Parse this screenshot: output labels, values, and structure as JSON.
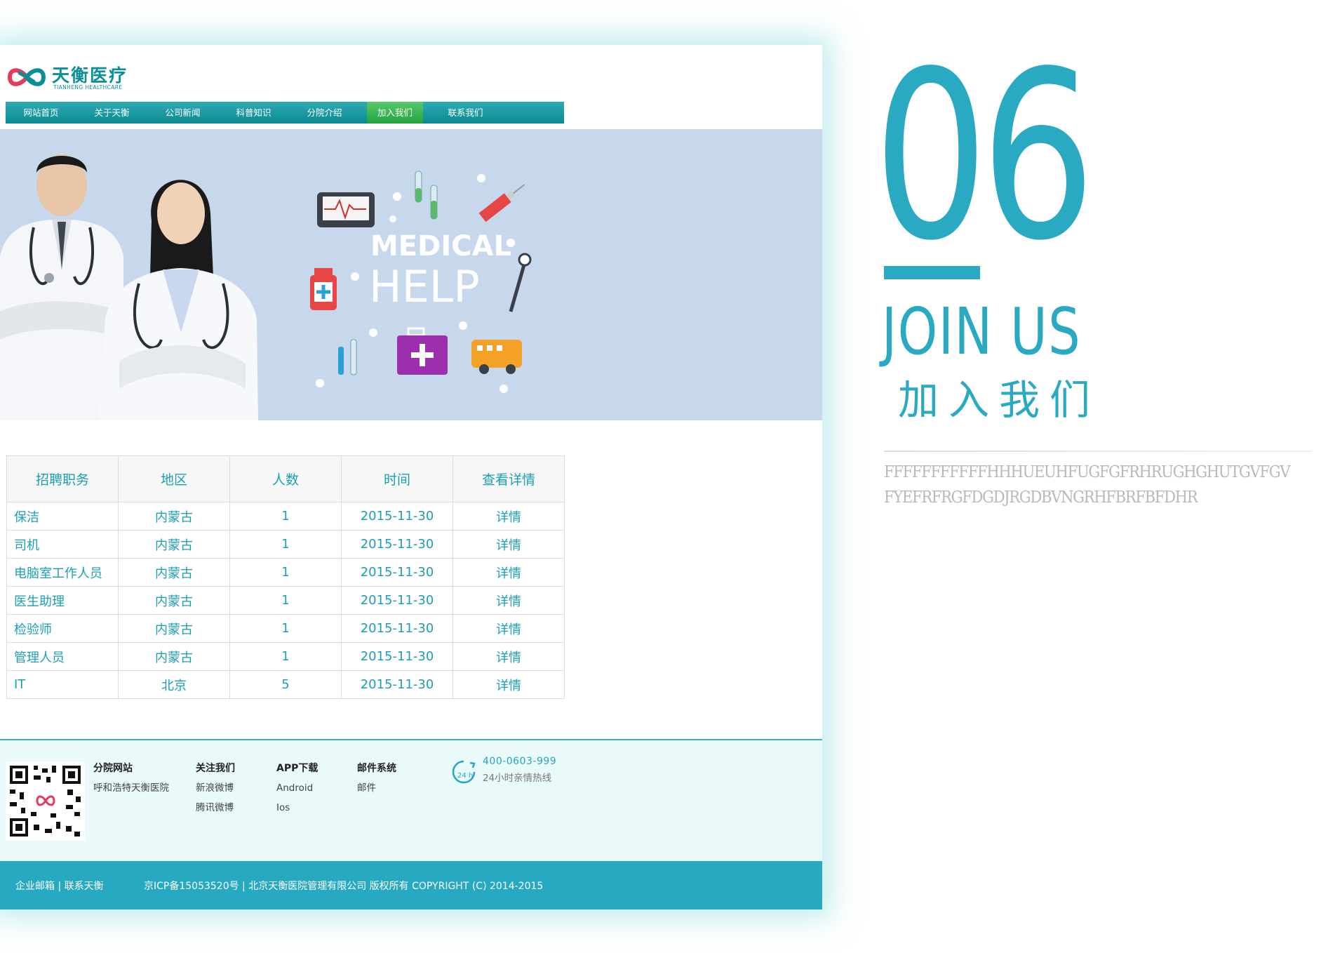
{
  "logo": {
    "name": "天衡医疗",
    "subtitle": "TIANHENG HEALTHCARE"
  },
  "nav": {
    "items": [
      {
        "label": "网站首页"
      },
      {
        "label": "关于天衡"
      },
      {
        "label": "公司新闻"
      },
      {
        "label": "科普知识"
      },
      {
        "label": "分院介绍"
      },
      {
        "label": "加入我们",
        "active": true
      },
      {
        "label": "联系我们"
      }
    ]
  },
  "banner": {
    "title_line1": "MEDICAL",
    "title_line2": "HELP"
  },
  "jobs": {
    "headers": [
      "招聘职务",
      "地区",
      "人数",
      "时间",
      "查看详情"
    ],
    "rows": [
      {
        "title": "保洁",
        "region": "内蒙古",
        "count": "1",
        "date": "2015-11-30",
        "detail": "详情"
      },
      {
        "title": "司机",
        "region": "内蒙古",
        "count": "1",
        "date": "2015-11-30",
        "detail": "详情"
      },
      {
        "title": "电脑室工作人员",
        "region": "内蒙古",
        "count": "1",
        "date": "2015-11-30",
        "detail": "详情"
      },
      {
        "title": "医生助理",
        "region": "内蒙古",
        "count": "1",
        "date": "2015-11-30",
        "detail": "详情"
      },
      {
        "title": "检验师",
        "region": "内蒙古",
        "count": "1",
        "date": "2015-11-30",
        "detail": "详情"
      },
      {
        "title": "管理人员",
        "region": "内蒙古",
        "count": "1",
        "date": "2015-11-30",
        "detail": "详情"
      },
      {
        "title": "IT",
        "region": "北京",
        "count": "5",
        "date": "2015-11-30",
        "detail": "详情"
      }
    ]
  },
  "footer": {
    "branch": {
      "title": "分院网站",
      "items": [
        "呼和浩特天衡医院"
      ]
    },
    "follow": {
      "title": "关注我们",
      "items": [
        "新浪微博",
        "腾讯微博"
      ]
    },
    "app": {
      "title": "APP下载",
      "items": [
        "Android",
        "Ios"
      ]
    },
    "mail": {
      "title": "邮件系统",
      "items": [
        "邮件"
      ]
    },
    "hotline": {
      "number": "400-0603-999",
      "text": "24小时亲情热线",
      "icon_label": "24 h"
    },
    "bottom_links": "企业邮箱 | 联系天衡",
    "copyright": "京ICP备15053520号 | 北京天衡医院管理有限公司 版权所有 COPYRIGHT (C) 2014-2015"
  },
  "side": {
    "number": "06",
    "title_en": "JOIN US",
    "title_cn": "加入我们",
    "filler_line1": "FFFFFFFFFFFHHHUEUHFUGFGFRHRUGHGHUTGVFGV",
    "filler_line2": "FYEFRFRGFDGDJRGDBVNGRHFBRFBFDHR"
  },
  "colors": {
    "brand": "#2aaac2",
    "nav": "#0b8a91",
    "nav_active": "#23a33e",
    "banner_bg": "#c7d8ec"
  }
}
